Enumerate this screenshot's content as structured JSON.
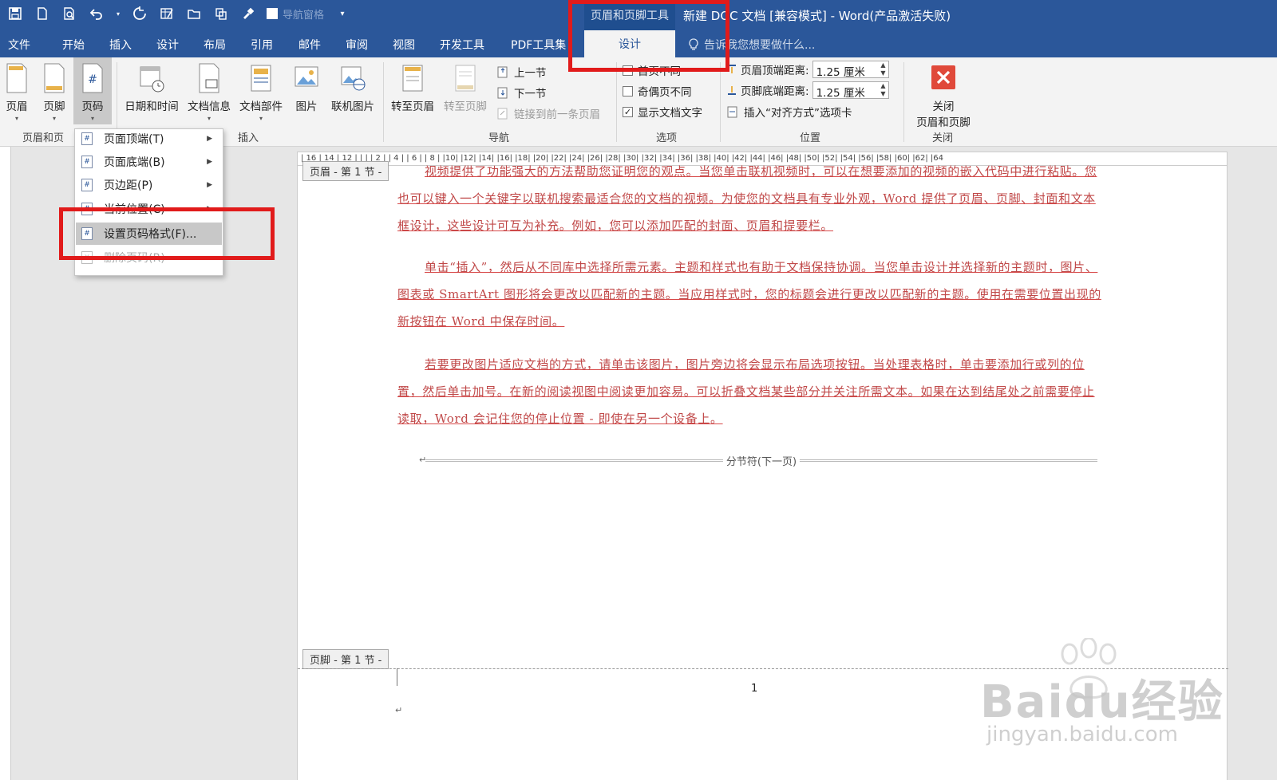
{
  "titlebar": {
    "nav_checkbox_label": "导航窗格",
    "context_tools": "页眉和页脚工具",
    "doc_title": "新建 DOC 文档 [兼容模式] - Word(产品激活失败)"
  },
  "tabs": {
    "file": "文件",
    "home": "开始",
    "insert": "插入",
    "design1": "设计",
    "layout": "布局",
    "references": "引用",
    "mailings": "邮件",
    "review": "审阅",
    "view": "视图",
    "developer": "开发工具",
    "pdf": "PDF工具集",
    "design_active": "设计",
    "tellme": "告诉我您想要做什么..."
  },
  "ribbon": {
    "header": "页眉",
    "footer": "页脚",
    "page_number": "页码",
    "group_hf": "页眉和页",
    "date_time": "日期和时间",
    "doc_info": "文档信息",
    "doc_parts": "文档部件",
    "picture": "图片",
    "online_picture": "联机图片",
    "group_insert": "插入",
    "goto_header": "转至页眉",
    "goto_footer": "转至页脚",
    "prev_section": "上一节",
    "next_section": "下一节",
    "link_prev": "链接到前一条页眉",
    "group_nav": "导航",
    "diff_first": "首页不同",
    "diff_odd_even": "奇偶页不同",
    "show_doc_text": "显示文档文字",
    "group_options": "选项",
    "header_top_label": "页眉顶端距离:",
    "header_top_value": "1.25 厘米",
    "footer_bottom_label": "页脚底端距离:",
    "footer_bottom_value": "1.25 厘米",
    "insert_align_tab": "插入“对齐方式”选项卡",
    "group_position": "位置",
    "close_line1": "关闭",
    "close_line2": "页眉和页脚",
    "group_close": "关闭"
  },
  "dropdown": {
    "top_of_page": "页面顶端(T)",
    "bottom_of_page": "页面底端(B)",
    "page_margins": "页边距(P)",
    "current_position": "当前位置(C)",
    "format_page_numbers": "设置页码格式(F)...",
    "remove_page_numbers": "删除页码(R)"
  },
  "ruler": {
    "h": "| 16 |  14 |  12 |  | |  | 2 |  | 4 |  | 6 |  | 8 |  |10|  |12|  |14|  |16|  |18|  |20|  |22|  |24|  |26|  |28|  |30|  |32|  |34|  |36|  |38|  |40|  |42|  |44|  |46|  |48|  |50|  |52|  |54|  |56|  |58|  |60|  |62|  |64"
  },
  "document": {
    "header_tag": "页眉 - 第 1 节 -",
    "para1_line0": "视频提供了功能强大的方法帮助您证明您的观点。当您单击联机视频时，可以在想要添加的视频的嵌入代码中",
    "para1_rest": "进行粘贴。您也可以键入一个关键字以联机搜索最适合您的文档的视频。为使您的文档具有专业外观，Word 提供了页眉、页脚、封面和文本框设计，这些设计可互为补充。例如，您可以添加匹配的封面、页眉和提要栏。",
    "para2": "单击“插入”，然后从不同库中选择所需元素。主题和样式也有助于文档保持协调。当您单击设计并选择新的主题时，图片、图表或 SmartArt 图形将会更改以匹配新的主题。当应用样式时，您的标题会进行更改以匹配新的主题。使用在需要位置出现的新按钮在 Word 中保存时间。",
    "para3": "若要更改图片适应文档的方式，请单击该图片，图片旁边将会显示布局选项按钮。当处理表格时，单击要添加行或列的位置，然后单击加号。在新的阅读视图中阅读更加容易。可以折叠文档某些部分并关注所需文本。如果在达到结尾处之前需要停止读取，Word 会记住您的停止位置 - 即使在另一个设备上。",
    "section_break": "分节符(下一页)",
    "footer_tag": "页脚 - 第 1 节 -",
    "page_number": "1"
  },
  "watermark": {
    "brand": "Baidu经验",
    "url": "jingyan.baidu.com"
  },
  "colors": {
    "accent": "#2b579a",
    "highlight": "#e11b1b",
    "revision_text": "#c04848"
  }
}
